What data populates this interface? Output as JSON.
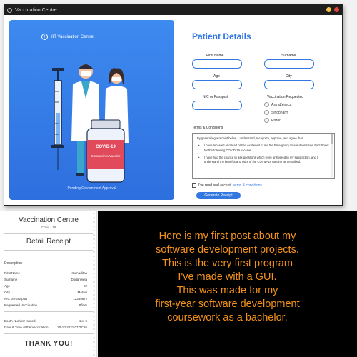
{
  "window": {
    "title": "Vaccination Centre",
    "brand": "IIT Vaccination Centre",
    "footer": "Pending Government Approval",
    "illustration": {
      "label_top": "COVID-19",
      "label_main": "Coronavirus Vaccine"
    }
  },
  "form": {
    "heading": "Patient Details",
    "first_name_label": "First Name",
    "surname_label": "Surname",
    "age_label": "Age",
    "city_label": "City",
    "nic_label": "NIC or Passport",
    "vaccination_label": "Vaccination Requested",
    "vaccines": [
      "AstraZeneca",
      "Sinopharm",
      "Pfizer"
    ],
    "terms_label": "Terms & Conditions",
    "terms_intro": "By generating a receipt below, I understand, recognize, approve, and agree that:",
    "terms_bullets": [
      "I have received and read or had explained to me the Emergency Use Authorization Fact Sheet for the following COVID-19 vaccine.",
      "I have had the chance to ask questions which were answered to my satisfaction, and I understand the benefits and risks of the COVID-19 vaccine as described."
    ],
    "agree_text": "I've read and accept",
    "agree_link": "terms & conditions",
    "generate_button": "Generate Receipt"
  },
  "receipt": {
    "title": "Vaccination Centre",
    "subtitle": "Covid - 19",
    "heading": "Detail Receipt",
    "section": "Description",
    "rows": [
      {
        "label": "First Name",
        "value": "Kumuditha"
      },
      {
        "label": "Surname",
        "value": "Dodanwela"
      },
      {
        "label": "Age",
        "value": "22"
      },
      {
        "label": "City",
        "value": "Matale"
      },
      {
        "label": "NIC or Passport",
        "value": "1234567v"
      },
      {
        "label": "Requested Vaccination",
        "value": "Pfizer"
      }
    ],
    "rows2": [
      {
        "label": "Booth Number Issued",
        "value": "4 or 5"
      },
      {
        "label": "Date & Time of the Vaccination",
        "value": "20-10-2021 07:27:26"
      }
    ],
    "thanks": "THANK YOU!"
  },
  "caption": {
    "text": "Here is my first post about my\nsoftware development projects.\nThis is the very first program\nI've made with a GUI.\nThis was made for my\nfirst-year software development\ncoursework as a bachelor."
  },
  "colors": {
    "accent": "#3377e0",
    "panel": "#2e6fde",
    "caption": "#f2911b"
  }
}
